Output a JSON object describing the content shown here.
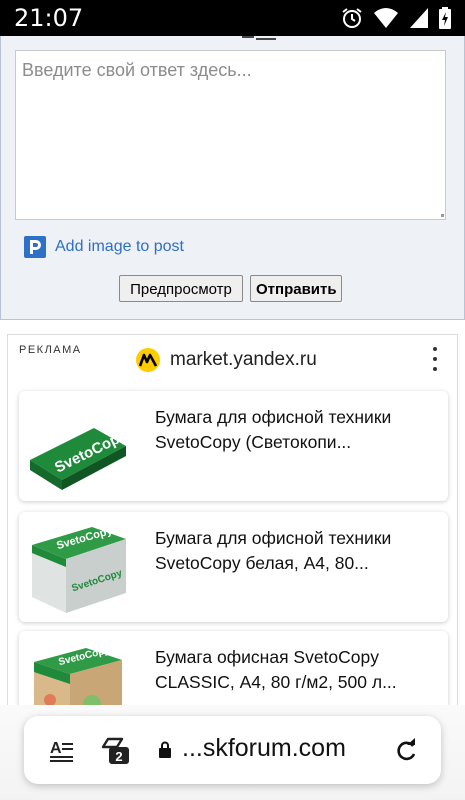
{
  "status_bar": {
    "time": "21:07",
    "icons": [
      "alarm-icon",
      "wifi-icon",
      "signal-icon",
      "battery-icon"
    ]
  },
  "reply_form": {
    "placeholder": "Введите свой ответ здесь...",
    "add_image_label": "Add image to post",
    "preview_button": "Предпросмотр",
    "send_button": "Отправить"
  },
  "ad": {
    "label": "РЕКЛАМА",
    "source": "market.yandex.ru",
    "items": [
      {
        "title": "Бумага для офисной техники SvetoCopy (Светокопи..."
      },
      {
        "title": "Бумага для офисной техники SvetoCopy белая, А4, 80..."
      },
      {
        "title": "Бумага офисная SvetoCopy CLASSIC, А4, 80 г/м2, 500 л..."
      }
    ]
  },
  "browser_bar": {
    "tab_count": "2",
    "url": "...skforum.com"
  },
  "colors": {
    "link_blue": "#2e6fc7",
    "form_bg": "#eef1f6",
    "brand_green": "#1e8a3a",
    "yandex_yellow": "#ffcc00"
  }
}
